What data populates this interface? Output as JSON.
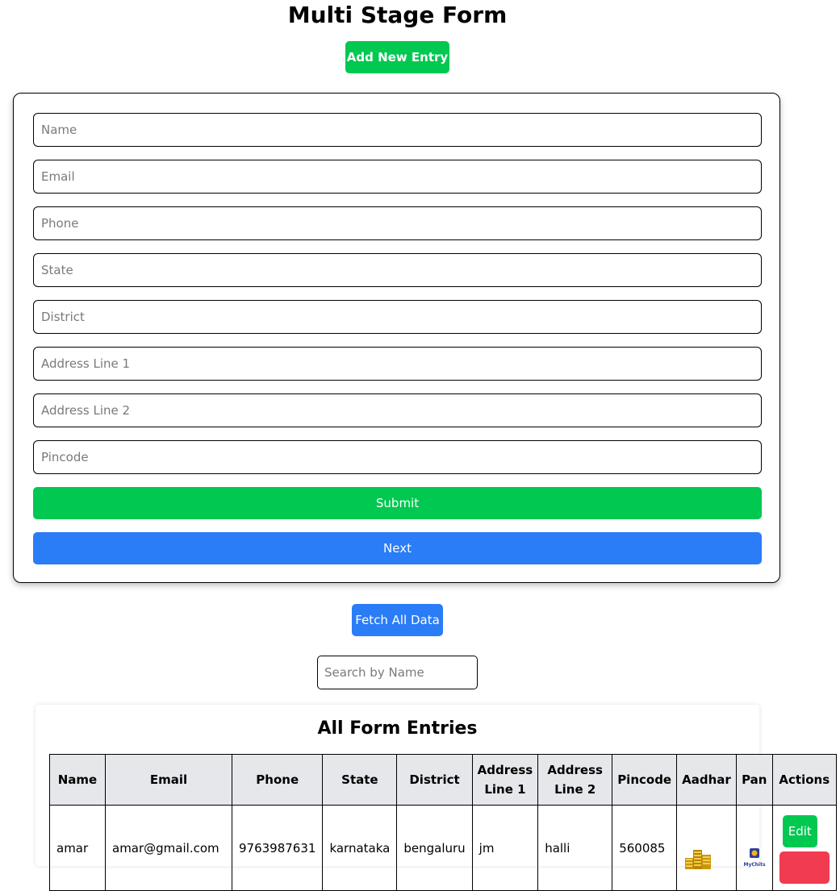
{
  "page": {
    "title": "Multi Stage Form"
  },
  "header": {
    "add_entry_label": "Add New Entry"
  },
  "form": {
    "fields": {
      "name": "Name",
      "email": "Email",
      "phone": "Phone",
      "state": "State",
      "district": "District",
      "address1": "Address Line 1",
      "address2": "Address Line 2",
      "pincode": "Pincode"
    },
    "submit_label": "Submit",
    "next_label": "Next"
  },
  "fetch_label": "Fetch All Data",
  "search": {
    "placeholder": "Search by Name"
  },
  "entries": {
    "title": "All Form Entries",
    "columns": [
      "Name",
      "Email",
      "Phone",
      "State",
      "District",
      "Address Line 1",
      "Address Line 2",
      "Pincode",
      "Aadhar",
      "Pan",
      "Actions"
    ],
    "rows": [
      {
        "name": "amar",
        "email": "amar@gmail.com",
        "phone": "9763987631",
        "state": "karnataka",
        "district": "bengaluru",
        "address1": "jm",
        "address2": "halli",
        "pincode": "560085",
        "aadhar_icon": "gold-coins-image",
        "pan_icon": "mychits-logo-image",
        "edit_label": "Edit"
      }
    ]
  },
  "colors": {
    "green": "#00c850",
    "blue": "#2a7cf7",
    "red": "#f03b50",
    "header_bg": "#e5e7eb"
  }
}
